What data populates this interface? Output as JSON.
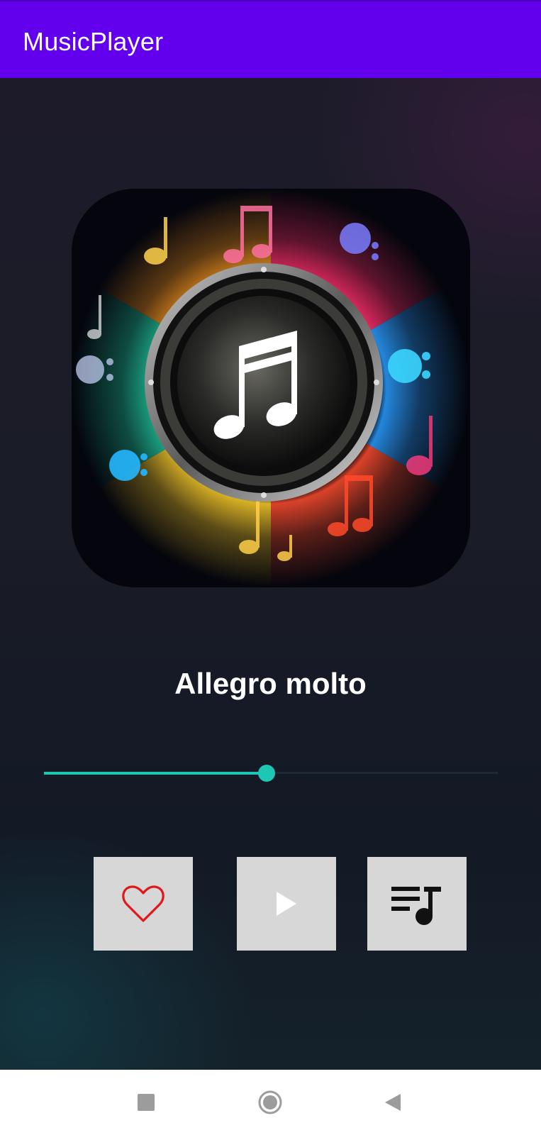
{
  "app_bar": {
    "title": "MusicPlayer"
  },
  "player": {
    "album_art_icon": "music-note-icon",
    "track_title": "Allegro molto",
    "seek_progress_fraction": 0.49,
    "accent_color": "#1ec7b4"
  },
  "controls": {
    "favorite_icon": "heart-outline-icon",
    "favorite_color": "#e0181b",
    "play_icon": "play-icon",
    "playlist_icon": "queue-music-icon"
  },
  "nav_bar": {
    "recents_icon": "square-icon",
    "home_icon": "circle-icon",
    "back_icon": "triangle-back-icon"
  },
  "colors": {
    "app_bar": "#6200ee",
    "background": "#1a1c27",
    "button_bg": "#d6d7d6"
  }
}
